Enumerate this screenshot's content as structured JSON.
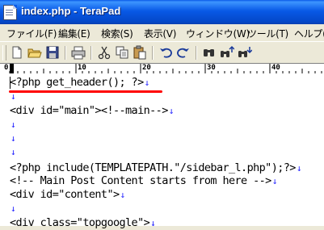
{
  "window": {
    "title": "index.php - TeraPad"
  },
  "menu": {
    "items": [
      "ファイル(F)",
      "編集(E)",
      "検索(S)",
      "表示(V)",
      "ウィンドウ(W)",
      "ツール(T)",
      "ヘルプ(H"
    ]
  },
  "toolbar": {
    "buttons": [
      "new-file-icon",
      "open-folder-icon",
      "save-icon",
      "print-icon",
      "cut-icon",
      "copy-icon",
      "paste-icon",
      "undo-icon",
      "redo-icon",
      "find-icon",
      "find-next-icon",
      "find-prev-icon"
    ]
  },
  "ruler": {
    "labels": [
      "0",
      "10",
      "20",
      "30",
      "40"
    ]
  },
  "editor": {
    "lines": [
      "<?php get_header(); ?>",
      "",
      "<div id=\"main\"><!--main-->",
      "",
      "",
      "",
      "<?php include(TEMPLATEPATH.\"/sidebar_l.php\");?>",
      "<!-- Main Post Content starts from here -->",
      "<div id=\"content\">",
      "",
      "<div class=\"topgoogle\">"
    ],
    "crlf_mark": "↓"
  },
  "colors": {
    "titlebar": "#0859e6",
    "crlf": "#2020ff",
    "highlight_underline": "#ff0000"
  }
}
